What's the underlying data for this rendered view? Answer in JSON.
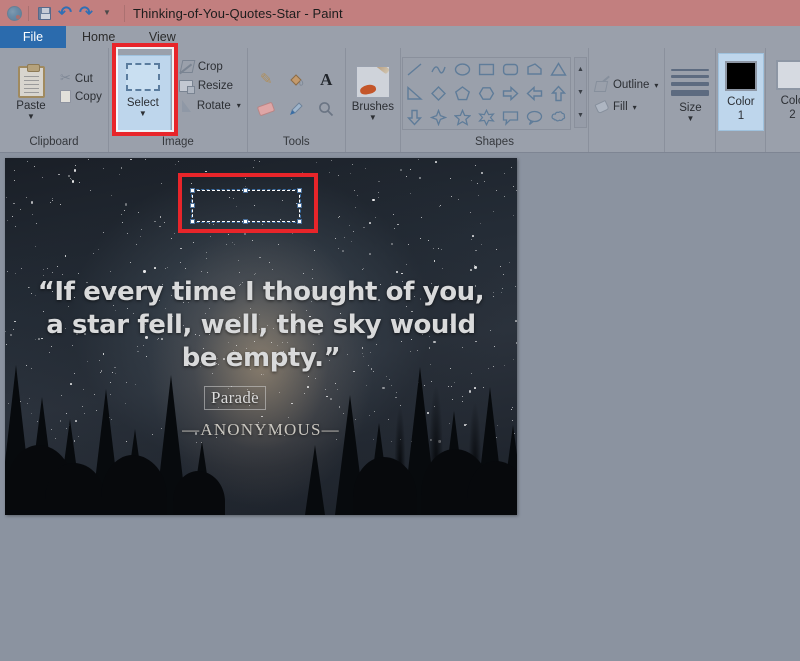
{
  "window": {
    "title": "Thinking-of-You-Quotes-Star - Paint",
    "quick_access": {
      "app_icon": "paint-palette-icon",
      "save": "save-icon",
      "undo": "undo-icon",
      "redo": "redo-icon",
      "more": "chevron-down-icon"
    }
  },
  "tabs": [
    {
      "label": "File",
      "active": true
    },
    {
      "label": "Home",
      "active": false
    },
    {
      "label": "View",
      "active": false
    }
  ],
  "ribbon": {
    "groups": [
      {
        "name": "Clipboard",
        "label": "Clipboard",
        "paste": {
          "label": "Paste",
          "icon": "clipboard-icon",
          "caret": "▼"
        },
        "items": [
          {
            "label": "Cut",
            "icon": "scissors-icon"
          },
          {
            "label": "Copy",
            "icon": "copy-icon"
          }
        ]
      },
      {
        "name": "Image",
        "label": "Image",
        "select": {
          "label": "Select",
          "icon": "selection-rectangle-icon",
          "caret": "▼",
          "highlighted": true
        },
        "items": [
          {
            "label": "Crop",
            "icon": "crop-icon",
            "caret": ""
          },
          {
            "label": "Resize",
            "icon": "resize-icon",
            "caret": ""
          },
          {
            "label": "Rotate",
            "icon": "rotate-icon",
            "caret": "▾"
          }
        ]
      },
      {
        "name": "Tools",
        "label": "Tools",
        "tools": [
          {
            "name": "pencil",
            "glyph": "✏"
          },
          {
            "name": "fill-with-color",
            "glyph": "🪣"
          },
          {
            "name": "text",
            "glyph": "A"
          },
          {
            "name": "eraser",
            "glyph": ""
          },
          {
            "name": "color-picker",
            "glyph": "💧"
          },
          {
            "name": "magnifier",
            "glyph": "🔍"
          }
        ]
      },
      {
        "name": "Brushes",
        "label": "",
        "brushes": {
          "label": "Brushes",
          "icon": "paintbrush-icon",
          "caret": "▼"
        }
      },
      {
        "name": "Shapes",
        "label": "Shapes",
        "shapes": [
          "line",
          "curve",
          "oval",
          "rectangle",
          "rounded-rectangle",
          "polygon",
          "triangle",
          "right-triangle",
          "diamond",
          "pentagon",
          "hexagon",
          "right-arrow",
          "left-arrow",
          "up-arrow",
          "down-arrow",
          "four-point-star",
          "five-point-star",
          "six-point-star",
          "rectangular-callout",
          "oval-callout",
          "cloud-callout"
        ],
        "scroll": {
          "up": "▲",
          "down": "▼",
          "more": "▼"
        }
      },
      {
        "name": "OutlineFill",
        "label": "",
        "items": [
          {
            "label": "Outline",
            "icon": "outline-icon",
            "caret": "▾"
          },
          {
            "label": "Fill",
            "icon": "fill-icon",
            "caret": "▾"
          }
        ]
      },
      {
        "name": "Size",
        "label": "",
        "size": {
          "label": "Size",
          "caret": "▼",
          "icon": "line-thickness-icon"
        }
      },
      {
        "name": "Color1",
        "label": "",
        "color": {
          "title": "Color",
          "number": "1",
          "swatch": "#000000",
          "active": true
        }
      },
      {
        "name": "Color2",
        "label": "",
        "color": {
          "title": "Colo",
          "number": "2",
          "swatch": "#d6dae1",
          "active": false
        }
      }
    ]
  },
  "canvas": {
    "image": {
      "quote": "“If every time I thought of you, a star fell, well, the sky would be empty.”",
      "attribution": "—ANONYMOUS—",
      "watermark": "Parade"
    },
    "selection": {
      "active": true,
      "style": "dashed-marquee",
      "handles": 8
    }
  },
  "annotations": {
    "select_button_highlight": {
      "color": "#e8252a",
      "target": "select-button"
    },
    "canvas_selection_highlight": {
      "color": "#e8252a",
      "target": "canvas-selection-marquee"
    }
  },
  "colors": {
    "titlebar": "#c27f7f",
    "ribbon": "#9aa0ab",
    "file_tab": "#2b6bad",
    "workspace": "#8b93a0",
    "annotation_red": "#e8252a",
    "highlight_blue": "#bed6ec"
  }
}
